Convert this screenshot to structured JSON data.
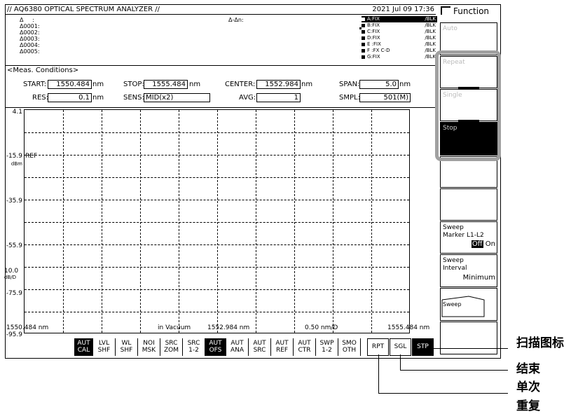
{
  "title": {
    "left": "// AQ6380 OPTICAL SPECTRUM ANALYZER //",
    "right": "2021 Jul 09 17:36"
  },
  "markers": {
    "delta": "Δ",
    "colon": ":",
    "rows": [
      "Δ0001:",
      "Δ0002:",
      "Δ0003:",
      "Δ0004:",
      "Δ0005:"
    ],
    "delta_delta": "Δ-Δn:"
  },
  "traces": [
    {
      "name": "A:FIX",
      "val": "/BLK",
      "selected": true
    },
    {
      "name": "B:FIX",
      "val": "/BLK"
    },
    {
      "name": "C:FIX",
      "val": "/BLK"
    },
    {
      "name": "D:FIX",
      "val": "/BLK"
    },
    {
      "name": "E :FIX",
      "val": "/BLK"
    },
    {
      "name": "F :FX C-D",
      "val": "/BLK"
    },
    {
      "name": "G:FIX",
      "val": "/BLK"
    }
  ],
  "meas": {
    "header": "<Meas. Conditions>",
    "start_label": "START:",
    "start_value": "1550.484",
    "start_unit": "nm",
    "stop_label": "STOP:",
    "stop_value": "1555.484",
    "stop_unit": "nm",
    "center_label": "CENTER:",
    "center_value": "1552.984",
    "center_unit": "nm",
    "span_label": "SPAN:",
    "span_value": "5.0",
    "span_unit": "nm",
    "res_label": "RES:",
    "res_value": "0.1",
    "res_unit": "nm",
    "sens_label": "SENS:",
    "sens_value": "MID(x2)",
    "avg_label": "AVG:",
    "avg_value": "1",
    "smpl_label": "SMPL:",
    "smpl_value": "501(M)"
  },
  "graph": {
    "y_labels": [
      "4.1",
      "-15.9",
      "-35.9",
      "-55.9",
      "-75.9",
      "-95.9"
    ],
    "ref_label": "REF",
    "dbm_unit": "dBm",
    "scale_value": "10.0",
    "scale_unit": "dB/D",
    "x_start": "1550.484 nm",
    "x_medium": "in Vacuum",
    "x_center": "1552.984 nm",
    "x_div": "0.50 nm/D",
    "x_stop": "1555.484 nm"
  },
  "function_button": {
    "icon": "function-icon",
    "label": "Function"
  },
  "softkeys": [
    {
      "label": "Auto",
      "state": "disabled"
    },
    {
      "label": "Repeat",
      "state": "disabled"
    },
    {
      "label": "Single",
      "state": "disabled"
    },
    {
      "label": "Stop",
      "state": "active"
    },
    {
      "label": "",
      "state": "normal"
    },
    {
      "label": "",
      "state": "normal"
    },
    {
      "label": "Sweep\nMarker L1-L2",
      "state": "normal",
      "toggle_off": "Off",
      "toggle_on": "On"
    },
    {
      "label": "Sweep\nInterval",
      "state": "normal",
      "value": "Minimum"
    },
    {
      "label": "Sweep",
      "state": "normal"
    },
    {
      "label": "",
      "state": "normal"
    }
  ],
  "toolbar": [
    {
      "l1": "AUT",
      "l2": "CAL",
      "inv": true
    },
    {
      "l1": "LVL",
      "l2": "SHF"
    },
    {
      "l1": "WL",
      "l2": "SHF"
    },
    {
      "l1": "NOI",
      "l2": "MSK"
    },
    {
      "l1": "SRC",
      "l2": "ZOM"
    },
    {
      "l1": "SRC",
      "l2": "1-2"
    },
    {
      "l1": "AUT",
      "l2": "OFS",
      "inv": true
    },
    {
      "l1": "AUT",
      "l2": "ANA"
    },
    {
      "l1": "AUT",
      "l2": "SRC"
    },
    {
      "l1": "AUT",
      "l2": "REF"
    },
    {
      "l1": "AUT",
      "l2": "CTR"
    },
    {
      "l1": "SWP",
      "l2": "1-2"
    },
    {
      "l1": "SMO",
      "l2": "OTH"
    }
  ],
  "run_buttons": {
    "rpt": "RPT",
    "sgl": "SGL",
    "stp": "STP"
  },
  "annotations": {
    "sweep_function_icon": "扫描图标",
    "stop": "结束",
    "single": "单次",
    "repeat": "重复"
  },
  "colors": {
    "highlight": "#a0a0a0",
    "active_key": "#000000"
  }
}
